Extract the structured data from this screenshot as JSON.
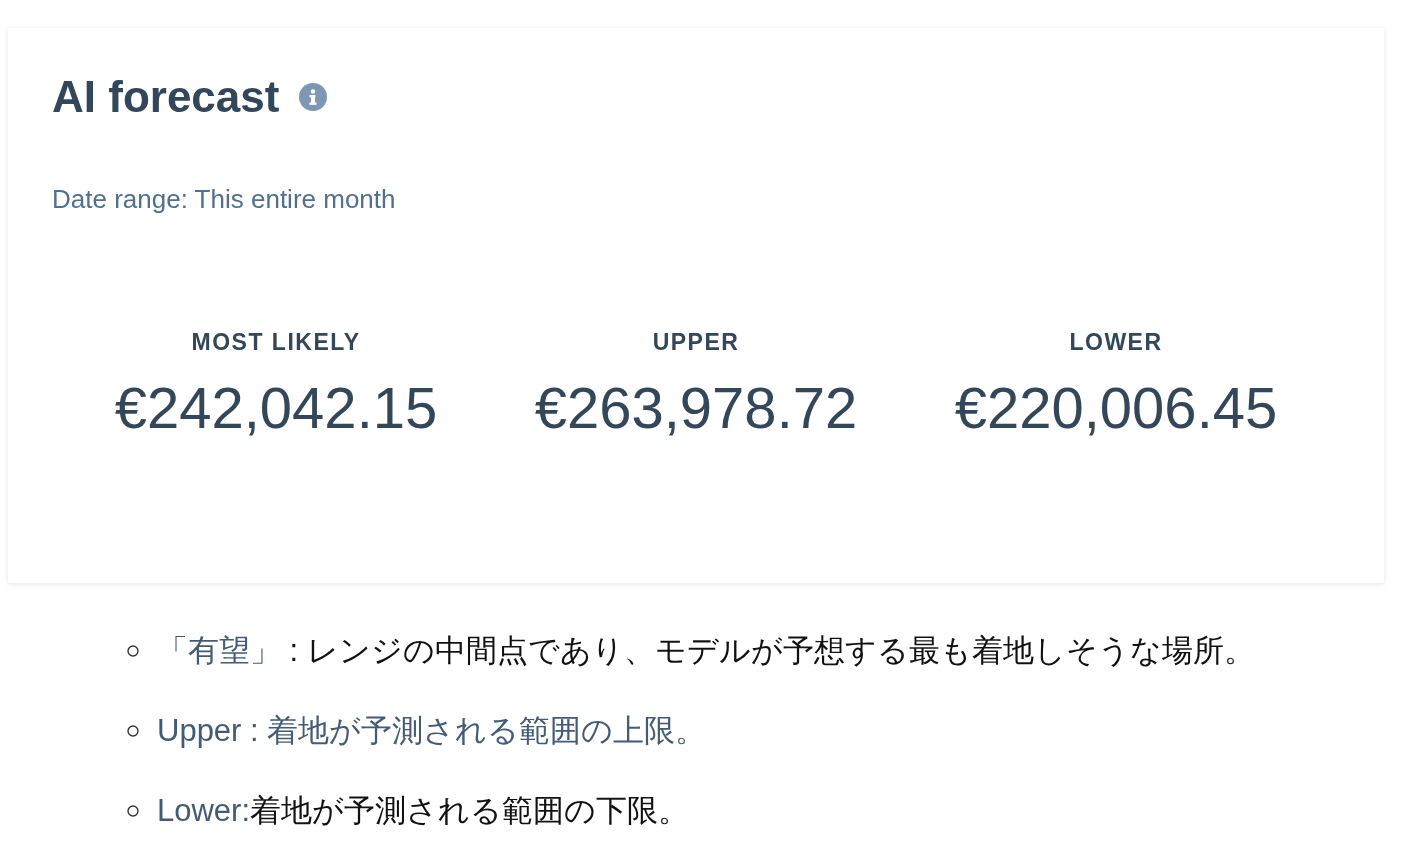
{
  "card": {
    "title": "AI forecast",
    "date_range": "Date range: This entire month",
    "stats": [
      {
        "label": "MOST LIKELY",
        "value": "€242,042.15"
      },
      {
        "label": "UPPER",
        "value": "€263,978.72"
      },
      {
        "label": "LOWER",
        "value": "€220,006.45"
      }
    ]
  },
  "notes": [
    {
      "segments": [
        {
          "text": "「有望」",
          "accent": true
        },
        {
          "text": " : レンジの中間点であり、モデルが予想する最も着地しそうな場所。",
          "accent": false
        }
      ]
    },
    {
      "segments": [
        {
          "text": "Upper : 着地が予測される範囲の上限。",
          "accent": true
        }
      ]
    },
    {
      "segments": [
        {
          "text": "Lower:",
          "accent": true
        },
        {
          "text": "着地が予測される範囲の下限。",
          "accent": false
        }
      ]
    }
  ]
}
